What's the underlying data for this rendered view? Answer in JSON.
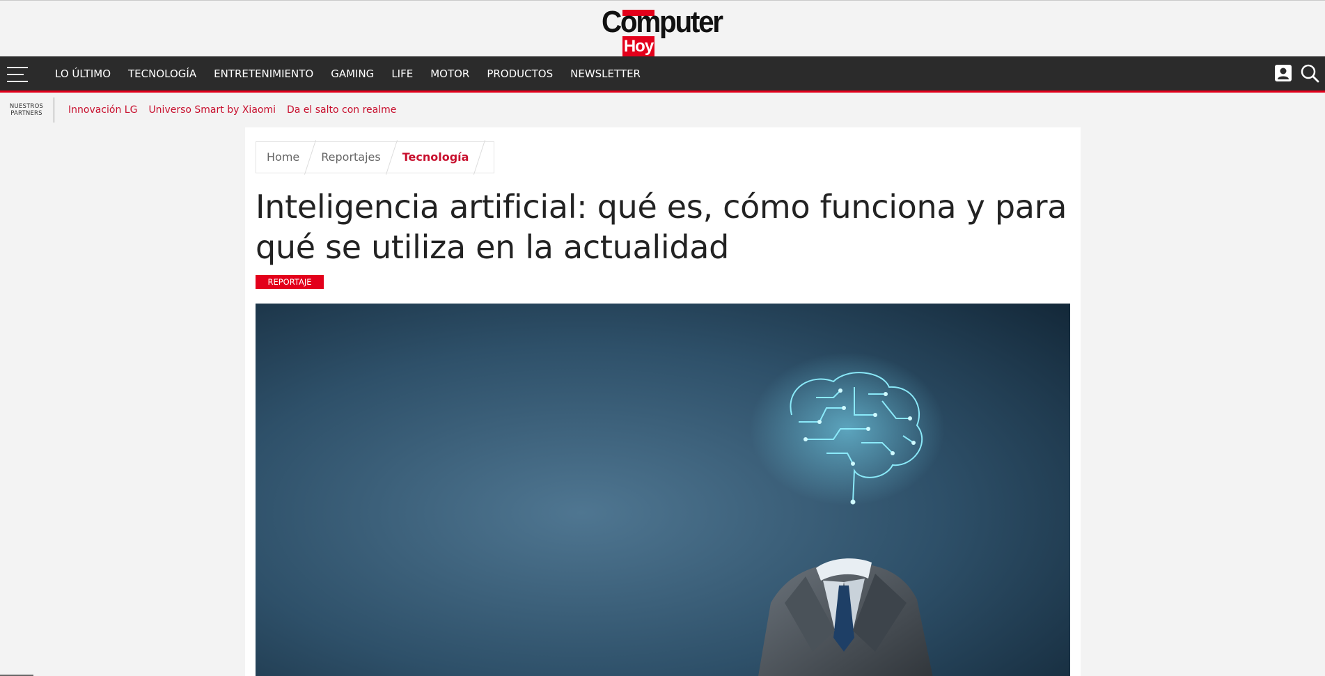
{
  "brand": {
    "logo_main": "Computer",
    "logo_sub": "Hoy"
  },
  "nav": {
    "items": [
      {
        "label": "LO ÚLTIMO"
      },
      {
        "label": "TECNOLOGÍA"
      },
      {
        "label": "ENTRETENIMIENTO"
      },
      {
        "label": "GAMING"
      },
      {
        "label": "LIFE"
      },
      {
        "label": "MOTOR"
      },
      {
        "label": "PRODUCTOS"
      },
      {
        "label": "NEWSLETTER"
      }
    ],
    "icons": [
      "menu-icon",
      "user-icon",
      "search-icon"
    ]
  },
  "partners": {
    "label_line1": "NUESTROS",
    "label_line2": "PARTNERS",
    "links": [
      {
        "label": "Innovación LG"
      },
      {
        "label": "Universo Smart by Xiaomi"
      },
      {
        "label": "Da el salto con realme"
      }
    ]
  },
  "breadcrumb": [
    {
      "label": "Home"
    },
    {
      "label": "Reportajes"
    },
    {
      "label": "Tecnología"
    }
  ],
  "article": {
    "title": "Inteligencia artificial: qué es, cómo funciona y para qué se utiliza en la actualidad",
    "badge": "REPORTAJE"
  },
  "colors": {
    "accent": "#e3001b",
    "nav_bg": "#2b2b2b",
    "link": "#c8102e"
  }
}
